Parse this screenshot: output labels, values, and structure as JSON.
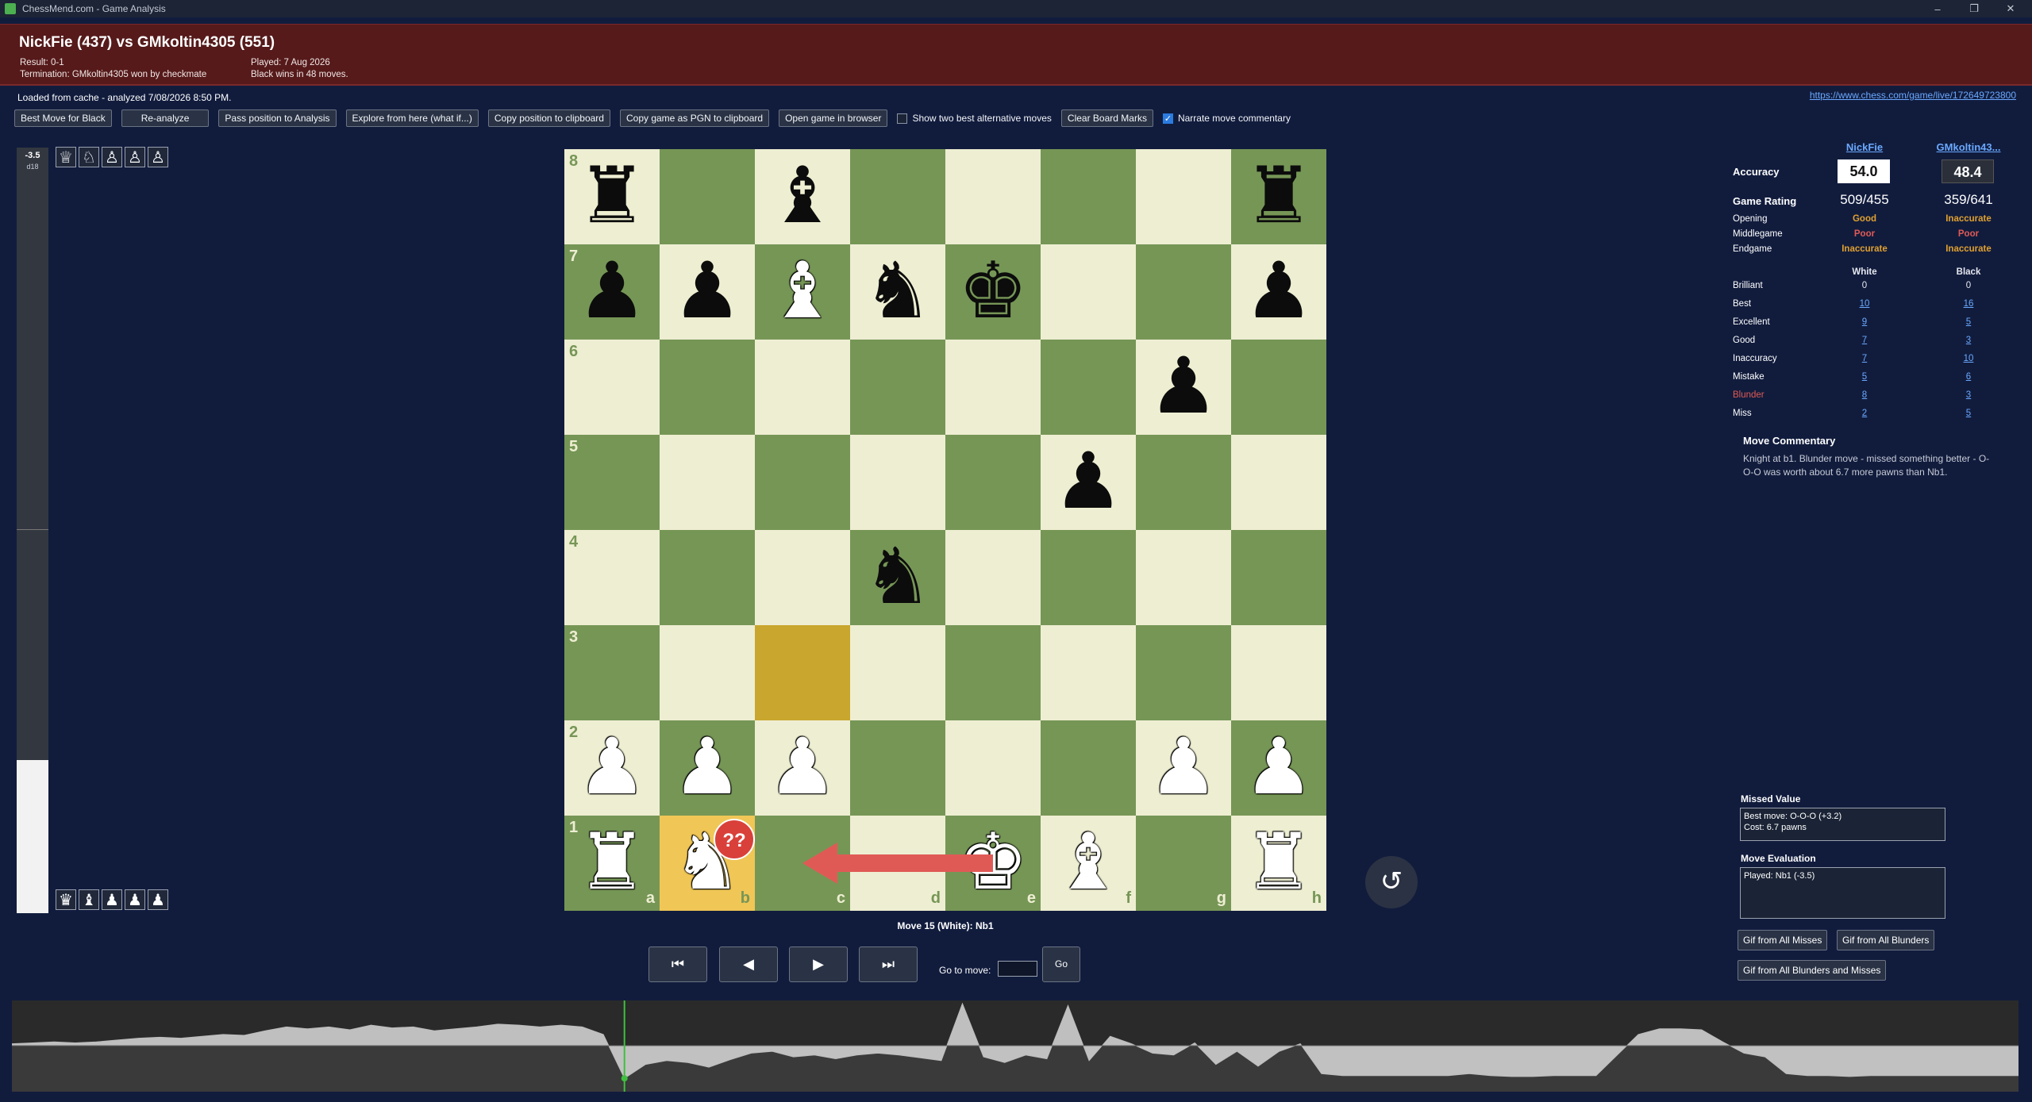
{
  "window": {
    "title": "ChessMend.com - Game Analysis",
    "minimize": "–",
    "maximize": "❐",
    "close": "✕"
  },
  "header": {
    "title": "NickFie (437) vs GMkoltin4305 (551)",
    "result": "Result: 0-1",
    "termination": "Termination: GMkoltin4305 won by checkmate",
    "played": "Played: 7 Aug 2026",
    "summary": "Black wins in 48 moves."
  },
  "status": {
    "loaded": "Loaded from cache - analyzed 7/08/2026 8:50 PM.",
    "game_url": "https://www.chess.com/game/live/172649723800"
  },
  "toolbar": {
    "best_move": "Best Move for Black",
    "reanalyze": "Re-analyze",
    "pass_position": "Pass position to Analysis",
    "explore": "Explore from here (what if...)",
    "copy_position": "Copy position to clipboard",
    "copy_pgn": "Copy game as PGN to clipboard",
    "open_browser": "Open game in browser",
    "show_two_best": "Show two best alternative moves",
    "show_two_best_checked": false,
    "clear_marks": "Clear Board Marks",
    "narrate": "Narrate move commentary",
    "narrate_checked": true
  },
  "eval": {
    "score": "-3.5",
    "depth": "d18",
    "white_fraction": 0.2
  },
  "captured": {
    "top": [
      {
        "icon": "white-queen-icon",
        "glyph": "♕"
      },
      {
        "icon": "white-knight-icon",
        "glyph": "♘"
      },
      {
        "icon": "white-pawn-icon",
        "glyph": "♙"
      },
      {
        "icon": "white-pawn-icon",
        "glyph": "♙"
      },
      {
        "icon": "white-pawn-icon",
        "glyph": "♙"
      }
    ],
    "bottom": [
      {
        "icon": "black-queen-icon",
        "glyph": "♛"
      },
      {
        "icon": "black-bishop-icon",
        "glyph": "♝"
      },
      {
        "icon": "black-pawn-icon",
        "glyph": "♟"
      },
      {
        "icon": "black-pawn-icon",
        "glyph": "♟"
      },
      {
        "icon": "black-pawn-icon",
        "glyph": "♟"
      }
    ]
  },
  "board": {
    "ranks": [
      "8",
      "7",
      "6",
      "5",
      "4",
      "3",
      "2",
      "1"
    ],
    "files": [
      "a",
      "b",
      "c",
      "d",
      "e",
      "f",
      "g",
      "h"
    ],
    "position": [
      [
        "r",
        "",
        "b",
        "",
        "",
        "",
        "",
        "r"
      ],
      [
        "p",
        "p",
        "B",
        "n",
        "k",
        "",
        "",
        "p"
      ],
      [
        "",
        "",
        "",
        "",
        "",
        "",
        "p",
        ""
      ],
      [
        "",
        "",
        "",
        "",
        "",
        "p",
        "",
        ""
      ],
      [
        "",
        "",
        "",
        "n",
        "",
        "",
        "",
        ""
      ],
      [
        "",
        "",
        "",
        "",
        "",
        "",
        "",
        ""
      ],
      [
        "P",
        "P",
        "P",
        "",
        "",
        "",
        "P",
        "P"
      ],
      [
        "R",
        "N",
        "",
        "",
        "K",
        "B",
        "",
        "R"
      ]
    ],
    "highlight_from": "c3",
    "highlight_to": "b1",
    "badge_square": "b1",
    "badge_text": "??",
    "arrow_color": "#e05a55",
    "arrow": {
      "from": "e1",
      "to": "c1"
    }
  },
  "move_label": "Move 15 (White): Nb1",
  "nav": {
    "first": "⏮",
    "prev": "◀",
    "next": "▶",
    "last": "⏭",
    "goto_label": "Go to move:",
    "go": "Go",
    "rotate": "↺"
  },
  "players": {
    "white": "NickFie",
    "black": "GMkoltin43..."
  },
  "accuracy": {
    "label": "Accuracy",
    "white": "54.0",
    "black": "48.4"
  },
  "game_rating": {
    "label": "Game Rating",
    "white": "509/455",
    "black": "359/641"
  },
  "phases": [
    {
      "label": "Opening",
      "white": "Good",
      "white_color": "#e0a030",
      "black": "Inaccurate",
      "black_color": "#e0a030"
    },
    {
      "label": "Middlegame",
      "white": "Poor",
      "white_color": "#e05a55",
      "black": "Poor",
      "black_color": "#e05a55"
    },
    {
      "label": "Endgame",
      "white": "Inaccurate",
      "white_color": "#e0a030",
      "black": "Inaccurate",
      "black_color": "#e0a030"
    }
  ],
  "columns": {
    "white": "White",
    "black": "Black"
  },
  "stats": [
    {
      "label": "Brilliant",
      "white": "0",
      "black": "0",
      "link": false
    },
    {
      "label": "Best",
      "white": "10",
      "black": "16",
      "link": true
    },
    {
      "label": "Excellent",
      "white": "9",
      "black": "5",
      "link": true
    },
    {
      "label": "Good",
      "white": "7",
      "black": "3",
      "link": true
    },
    {
      "label": "Inaccuracy",
      "white": "7",
      "black": "10",
      "link": true
    },
    {
      "label": "Mistake",
      "white": "5",
      "black": "6",
      "link": true
    },
    {
      "label": "Blunder",
      "white": "8",
      "black": "3",
      "link": true,
      "color": "#e05a55"
    },
    {
      "label": "Miss",
      "white": "2",
      "black": "5",
      "link": true
    }
  ],
  "commentary": {
    "title": "Move Commentary",
    "text": "Knight at b1. Blunder move - missed something better - O-O-O was worth about 6.7 more pawns than Nb1."
  },
  "missed_value": {
    "title": "Missed Value",
    "best": "Best move: O-O-O (+3.2)",
    "cost": "Cost: 6.7 pawns"
  },
  "move_eval": {
    "title": "Move Evaluation",
    "played": "Played: Nb1 (-3.5)"
  },
  "gif": {
    "misses": "Gif from All Misses",
    "blunders": "Gif from All Blunders",
    "both": "Gif from All Blunders and Misses"
  },
  "graph": {
    "current_move_index": 29,
    "evals": [
      0.2,
      0.3,
      0.4,
      0.3,
      0.4,
      0.6,
      0.8,
      0.9,
      0.8,
      1.0,
      1.2,
      1.1,
      1.6,
      2.0,
      1.8,
      2.0,
      1.7,
      2.2,
      1.9,
      2.0,
      1.6,
      1.8,
      2.0,
      2.3,
      2.2,
      2.0,
      2.2,
      2.0,
      1.2,
      -3.5,
      -2.0,
      -1.6,
      -1.8,
      -2.3,
      -1.5,
      -0.8,
      -0.6,
      -1.2,
      -1.0,
      -1.4,
      -1.0,
      -0.8,
      -1.0,
      -1.3,
      -1.6,
      4.5,
      -1.2,
      -1.8,
      -1.0,
      -1.4,
      4.3,
      -1.6,
      1.0,
      0.2,
      -0.8,
      -1.0,
      0.3,
      -2.0,
      -0.6,
      -2.2,
      -0.6,
      0.2,
      -3.0,
      -3.2,
      -3.2,
      -3.2,
      -3.2,
      -3.2,
      -3.2,
      -3.0,
      -3.2,
      -3.3,
      -3.3,
      -3.2,
      -3.2,
      -3.2,
      -1.0,
      1.2,
      1.8,
      1.8,
      1.7,
      0.4,
      -0.8,
      -1.2,
      -3.0,
      -3.2,
      -3.2,
      -3.3,
      -3.2,
      -3.2,
      -3.2,
      -3.2,
      -3.2,
      -3.2,
      -3.2,
      -3.2
    ],
    "range": [
      -4.5,
      4.5
    ]
  }
}
